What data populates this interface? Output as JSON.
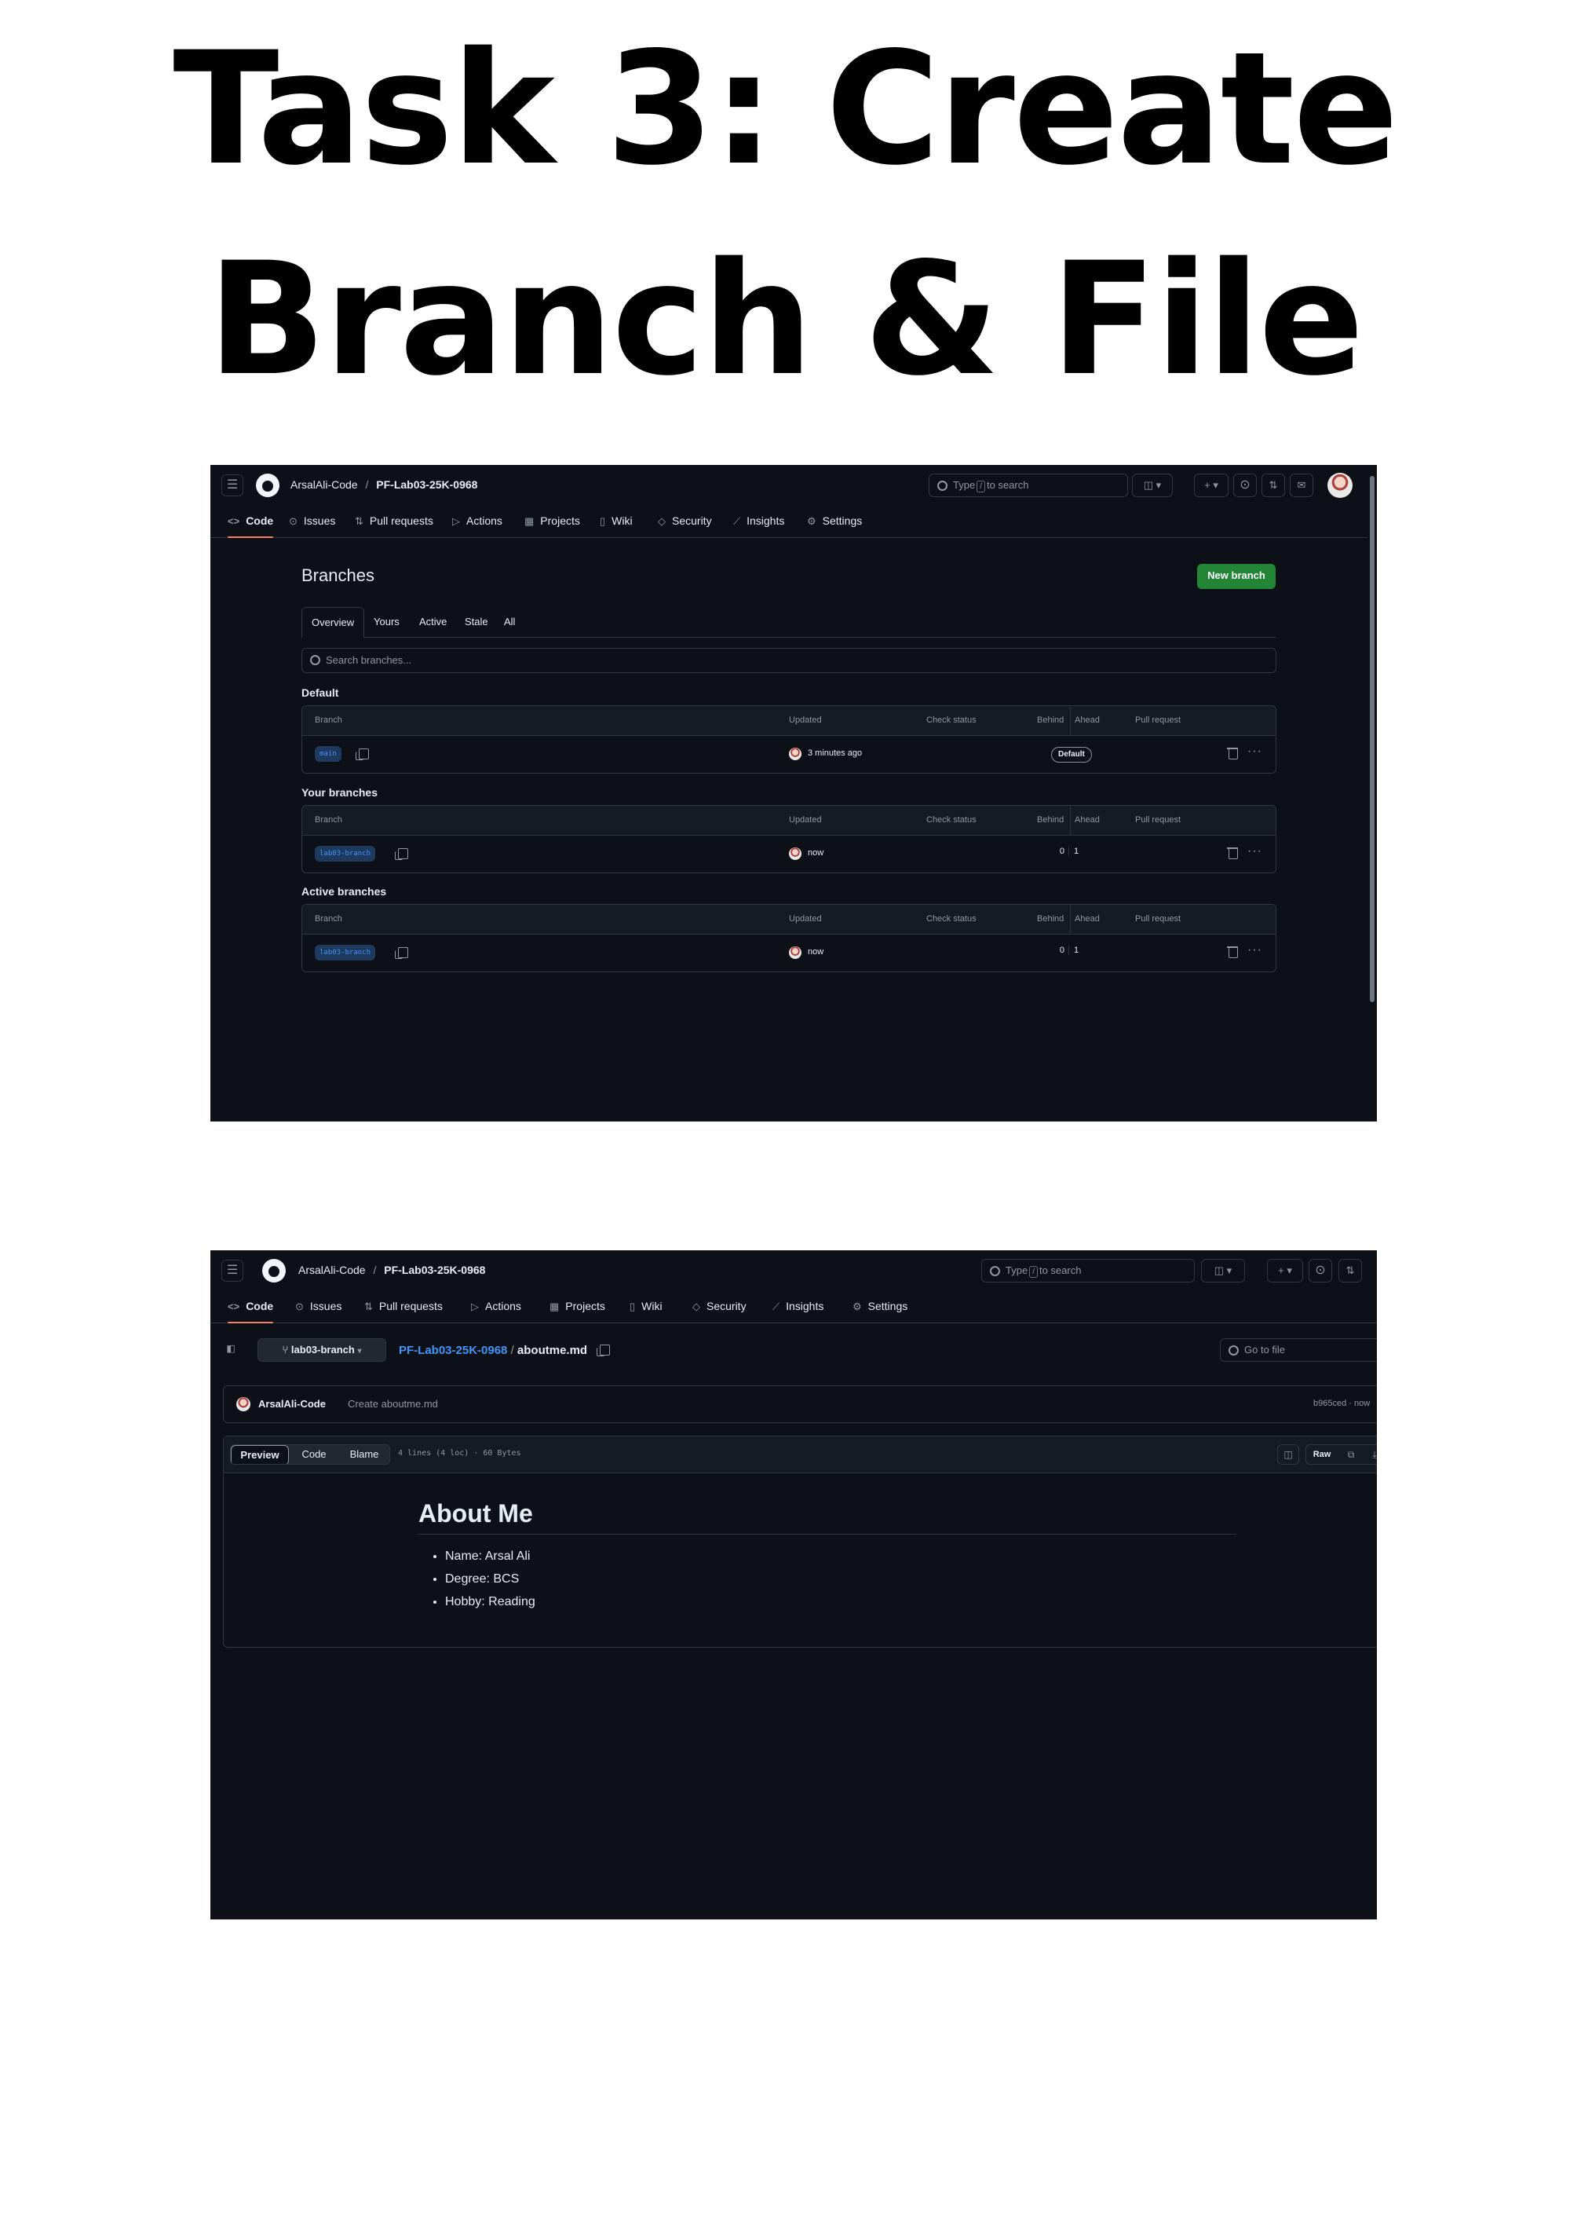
{
  "heading": {
    "line1": "Task 3: Create",
    "line2": "Branch & File"
  },
  "nav": {
    "owner": "ArsalAli-Code",
    "sep": "/",
    "repo": "PF-Lab03-25K-0968",
    "search_pre": "Type",
    "search_key": "/",
    "search_post": "to search",
    "plus": "+ ▾",
    "tabs": [
      "Code",
      "Issues",
      "Pull requests",
      "Actions",
      "Projects",
      "Wiki",
      "Security",
      "Insights",
      "Settings"
    ]
  },
  "branches_page": {
    "title": "Branches",
    "new_branch": "New branch",
    "filters": [
      "Overview",
      "Yours",
      "Active",
      "Stale",
      "All"
    ],
    "search_placeholder": "Search branches...",
    "columns": [
      "Branch",
      "Updated",
      "Check status",
      "Behind",
      "Ahead",
      "Pull request"
    ],
    "sections": [
      {
        "title": "Default",
        "branch": "main",
        "updated": "3 minutes ago",
        "behind": "",
        "ahead": "",
        "badge": "Default"
      },
      {
        "title": "Your branches",
        "branch": "lab03-branch",
        "updated": "now",
        "behind": "0",
        "ahead": "1",
        "badge": ""
      },
      {
        "title": "Active branches",
        "branch": "lab03-branch",
        "updated": "now",
        "behind": "0",
        "ahead": "1",
        "badge": ""
      }
    ]
  },
  "file_page": {
    "branch": "lab03-branch",
    "repo_link": "PF-Lab03-25K-0968",
    "path_sep": "/",
    "file": "aboutme.md",
    "goto_placeholder": "Go to file",
    "commit_author": "ArsalAli-Code",
    "commit_msg": "Create aboutme.md",
    "commit_meta": "b965ced · now",
    "view_tabs": [
      "Preview",
      "Code",
      "Blame"
    ],
    "file_meta": "4 lines (4 loc) · 60 Bytes",
    "raw": "Raw",
    "md_heading": "About Me",
    "md_items": [
      "Name: Arsal Ali",
      "Degree: BCS",
      "Hobby: Reading"
    ]
  },
  "colors": {
    "bg": "#0d1117",
    "border": "#30363d",
    "accent": "#f78166",
    "link": "#4493f8",
    "green": "#238636"
  }
}
